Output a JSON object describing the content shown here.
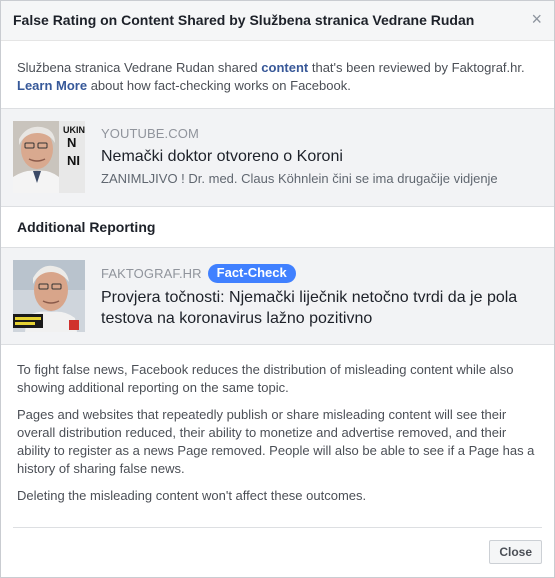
{
  "dialog": {
    "title": "False Rating on Content Shared by Službena stranica Vedrane Rudan",
    "close_icon": "×"
  },
  "intro": {
    "part1": "Službena stranica Vedrane Rudan shared ",
    "content_link": "content",
    "part2": " that's been reviewed by Faktograf.hr.",
    "learn_more": "Learn More",
    "part3": " about how fact-checking works on Facebook."
  },
  "shared_card": {
    "domain": "YOUTUBE.COM",
    "title": "Nemački doktor otvoreno o Koroni",
    "description": "ZANIMLJIVO ! Dr. med. Claus Köhnlein čini se ima drugačije vidjenje",
    "thumb_text": [
      "UKIN",
      "N",
      "NI"
    ]
  },
  "additional": {
    "heading": "Additional Reporting",
    "domain": "FAKTOGRAF.HR",
    "badge": "Fact-Check",
    "title": "Provjera točnosti: Njemački liječnik netočno tvrdi da je pola testova na koronavirus lažno pozitivno"
  },
  "info": {
    "p1": "To fight false news, Facebook reduces the distribution of misleading content while also showing additional reporting on the same topic.",
    "p2": "Pages and websites that repeatedly publish or share misleading content will see their overall distribution reduced, their ability to monetize and advertise removed, and their ability to register as a news Page removed. People will also be able to see if a Page has a history of sharing false news.",
    "p3": "Deleting the misleading content won't affect these outcomes."
  },
  "footer": {
    "close_label": "Close"
  },
  "colors": {
    "link": "#365899",
    "badge": "#4080ff",
    "card_bg": "#f2f3f5"
  }
}
